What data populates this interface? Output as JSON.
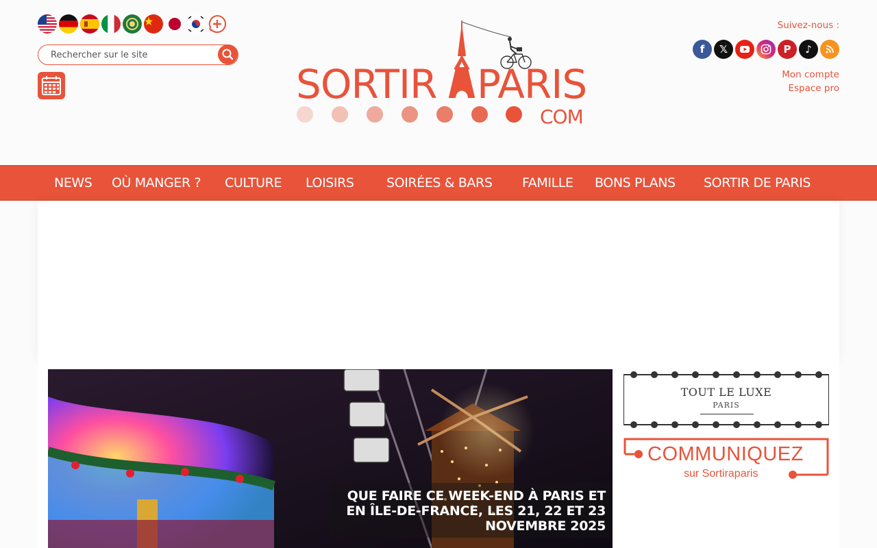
{
  "header": {
    "languages": [
      {
        "name": "english",
        "icon": "flag-us-icon"
      },
      {
        "name": "german",
        "icon": "flag-de-icon"
      },
      {
        "name": "spanish",
        "icon": "flag-es-icon"
      },
      {
        "name": "italian",
        "icon": "flag-it-icon"
      },
      {
        "name": "arabic",
        "icon": "flag-arab-icon"
      },
      {
        "name": "chinese",
        "icon": "flag-cn-icon"
      },
      {
        "name": "japanese",
        "icon": "flag-jp-icon"
      },
      {
        "name": "korean",
        "icon": "flag-kr-icon"
      },
      {
        "name": "more",
        "icon": "more-languages-icon"
      }
    ],
    "search": {
      "placeholder": "Rechercher sur le site"
    },
    "logo": {
      "text_main": "SORTIRAPARIS",
      "text_suffix": "COM"
    },
    "follow_label": "Suivez-nous :",
    "socials": [
      "facebook-icon",
      "x-icon",
      "youtube-icon",
      "instagram-icon",
      "pinterest-icon",
      "tiktok-icon",
      "rss-icon"
    ],
    "account_link": "Mon compte",
    "pro_link": "Espace pro"
  },
  "nav": {
    "items": [
      "NEWS",
      "OÙ MANGER ?",
      "CULTURE",
      "LOISIRS",
      "SOIRÉES & BARS",
      "FAMILLE",
      "BONS PLANS",
      "SORTIR DE PARIS"
    ]
  },
  "hero": {
    "title": "QUE FAIRE CE WEEK-END À PARIS ET EN ÎLE-DE-FRANCE, LES 21, 22 ET 23 NOVEMBRE 2025"
  },
  "sidebar": {
    "luxe_title": "TOUT LE LUXE",
    "luxe_sub": "PARIS",
    "com_title": "COMMUNIQUEZ",
    "com_sub": "sur Sortiraparis"
  },
  "colors": {
    "accent": "#e8533a",
    "background": "#fbfbfb"
  }
}
